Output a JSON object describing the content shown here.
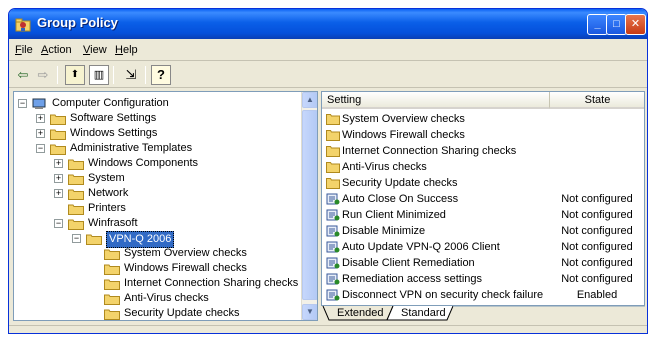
{
  "window": {
    "title": "Group Policy",
    "buttons": {
      "minimize": "_",
      "maximize": "□",
      "close": "✕"
    }
  },
  "menu": {
    "items": [
      {
        "label": "File",
        "accel": "F",
        "rest": "ile"
      },
      {
        "label": "Action",
        "accel": "A",
        "rest": "ction"
      },
      {
        "label": "View",
        "accel": "V",
        "rest": "iew"
      },
      {
        "label": "Help",
        "accel": "H",
        "rest": "elp"
      }
    ]
  },
  "toolbar": {
    "icons": [
      "back-arrow-icon",
      "forward-arrow-icon",
      "up-folder-icon",
      "show-hide-tree-icon",
      "export-list-icon",
      "help-icon"
    ],
    "glyphs": {
      "back": "⇦",
      "forward": "⇨",
      "up": "⬆",
      "tree": "▥",
      "export": "⇲",
      "help": "?"
    }
  },
  "tree": {
    "items": [
      {
        "label": "Computer Configuration",
        "expander": "−"
      },
      {
        "label": "Software Settings",
        "expander": "+"
      },
      {
        "label": "Windows Settings",
        "expander": "+"
      },
      {
        "label": "Administrative Templates",
        "expander": "−"
      },
      {
        "label": "Windows Components",
        "expander": "+"
      },
      {
        "label": "System",
        "expander": "+"
      },
      {
        "label": "Network",
        "expander": "+"
      },
      {
        "label": "Printers",
        "expander": ""
      },
      {
        "label": "Winfrasoft",
        "expander": "−"
      },
      {
        "label": "VPN-Q 2006",
        "expander": "−"
      },
      {
        "label": "System Overview checks",
        "expander": ""
      },
      {
        "label": "Windows Firewall checks",
        "expander": ""
      },
      {
        "label": "Internet Connection Sharing checks",
        "expander": ""
      },
      {
        "label": "Anti-Virus checks",
        "expander": ""
      },
      {
        "label": "Security Update checks",
        "expander": ""
      }
    ],
    "selected": "VPN-Q 2006"
  },
  "list": {
    "columns": {
      "setting": "Setting",
      "state": "State"
    },
    "rows": [
      {
        "name": "System Overview checks",
        "state": "",
        "icon": "folder-icon"
      },
      {
        "name": "Windows Firewall checks",
        "state": "",
        "icon": "folder-icon"
      },
      {
        "name": "Internet Connection Sharing checks",
        "state": "",
        "icon": "folder-icon"
      },
      {
        "name": "Anti-Virus checks",
        "state": "",
        "icon": "folder-icon"
      },
      {
        "name": "Security Update checks",
        "state": "",
        "icon": "folder-icon"
      },
      {
        "name": "Auto Close On Success",
        "state": "Not configured",
        "icon": "policy-setting-icon"
      },
      {
        "name": "Run Client Minimized",
        "state": "Not configured",
        "icon": "policy-setting-icon"
      },
      {
        "name": "Disable Minimize",
        "state": "Not configured",
        "icon": "policy-setting-icon"
      },
      {
        "name": "Auto Update VPN-Q 2006 Client",
        "state": "Not configured",
        "icon": "policy-setting-icon"
      },
      {
        "name": "Disable Client Remediation",
        "state": "Not configured",
        "icon": "policy-setting-icon"
      },
      {
        "name": "Remediation access settings",
        "state": "Not configured",
        "icon": "policy-setting-icon"
      },
      {
        "name": "Disconnect VPN on security check failure",
        "state": "Enabled",
        "icon": "policy-setting-icon"
      }
    ]
  },
  "tabs": [
    {
      "label": "Extended",
      "active": false
    },
    {
      "label": "Standard",
      "active": true
    }
  ],
  "colors": {
    "titlebar": "#0a5fe8",
    "selection": "#316ac5",
    "folder": "#f3d36b",
    "window_bg": "#ece9d8"
  }
}
